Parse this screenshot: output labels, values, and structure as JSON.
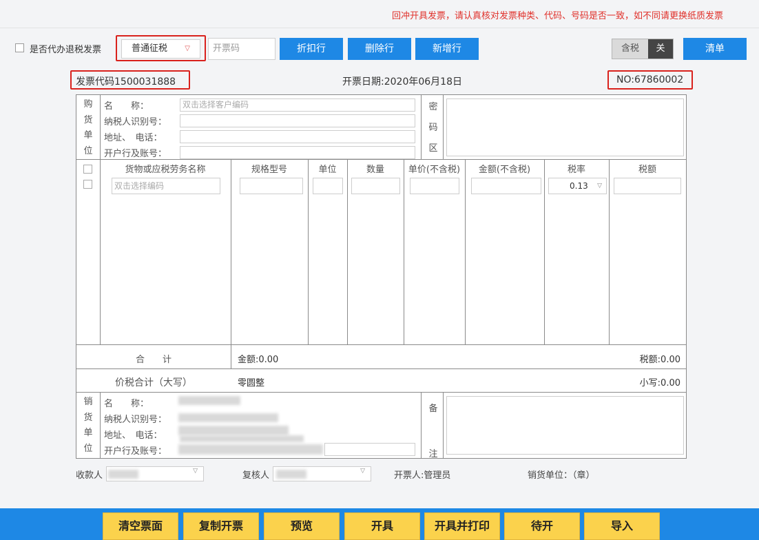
{
  "notice": "回冲开具发票，请认真核对发票种类、代码、号码是否一致，如不同请更换纸质发票",
  "toolbar": {
    "agent_label": "是否代办退税发票",
    "invoice_type": "普通征税",
    "code_placeholder": "开票码",
    "discount_label": "折扣行",
    "delete_label": "删除行",
    "add_label": "新增行",
    "tax_inclusive_label": "含税",
    "tax_toggle_off_label": "关",
    "list_label": "清单"
  },
  "header": {
    "invoice_code": "发票代码1500031888",
    "issue_date": "开票日期:2020年06月18日",
    "invoice_no": "NO:67860002"
  },
  "buyer": {
    "side_label": [
      "购",
      "货",
      "单",
      "位"
    ],
    "name_label": "名　　称：",
    "name_placeholder": "双击选择客户编码",
    "taxid_label": "纳税人识别号：",
    "addr_label": "地址、　电话：",
    "bank_label": "开户行及账号："
  },
  "cipher_label": [
    "密",
    "码",
    "区"
  ],
  "items": {
    "columns": [
      "货物或应税劳务名称",
      "规格型号",
      "单位",
      "数量",
      "单价(不含税)",
      "金额(不含税)",
      "税率",
      "税额"
    ],
    "name_placeholder": "双击选择编码",
    "tax_rate": "0.13"
  },
  "totals": {
    "total_label": "合　　计",
    "amount": "金额:0.00",
    "tax": "税额:0.00",
    "grand_label": "价税合计（大写）",
    "uppercase": "零圆整",
    "lowercase": "小写:0.00"
  },
  "seller": {
    "side_label": [
      "销",
      "货",
      "单",
      "位"
    ],
    "name_label": "名　　称：",
    "taxid_label": "纳税人识别号：",
    "addr_label": "地址、　电话：",
    "bank_label": "开户行及账号："
  },
  "remark_label": [
    "备",
    "注"
  ],
  "footer": {
    "payee_label": "收款人",
    "reviewer_label": "复核人",
    "drawer": "开票人:管理员",
    "seller_seal": "销货单位：（章）"
  },
  "actions": [
    "清空票面",
    "复制开票",
    "预览",
    "开具",
    "开具并打印",
    "待开",
    "导入"
  ]
}
